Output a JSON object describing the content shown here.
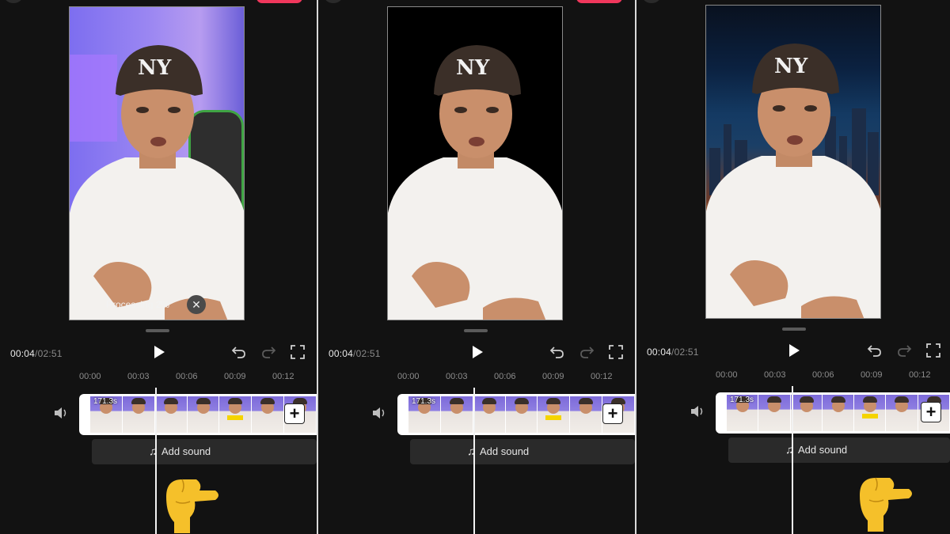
{
  "panels": [
    {
      "processing_label": "Processing 2%",
      "time": {
        "current": "00:04",
        "separator": "/",
        "total": "02:51"
      },
      "ticks": [
        "00:00",
        "00:03",
        "00:06",
        "00:09",
        "00:12"
      ],
      "clip_duration": "171.3s",
      "add_sound_label": "Add sound",
      "background": "purple-room"
    },
    {
      "time": {
        "current": "00:04",
        "separator": "/",
        "total": "02:51"
      },
      "ticks": [
        "00:00",
        "00:03",
        "00:06",
        "00:09",
        "00:12"
      ],
      "clip_duration": "171.3s",
      "add_sound_label": "Add sound",
      "background": "black"
    },
    {
      "time": {
        "current": "00:04",
        "separator": "/",
        "total": "02:51"
      },
      "ticks": [
        "00:00",
        "00:03",
        "00:06",
        "00:09",
        "00:12"
      ],
      "clip_duration": "171.3s",
      "add_sound_label": "Add sound",
      "background": "night-city"
    }
  ],
  "icons": {
    "play": "play-icon",
    "undo": "undo-icon",
    "redo": "redo-icon",
    "fullscreen": "fullscreen-icon",
    "volume": "speaker-icon",
    "add_clip": "plus-icon",
    "music": "music-note-icon",
    "close": "close-icon",
    "pointer": "pointing-hand-icon"
  },
  "glyphs": {
    "plus": "+",
    "note": "♫",
    "close": "✕"
  },
  "colors": {
    "accent": "#f0375c",
    "background": "#121212",
    "timeline_bg": "#2a2a2a"
  }
}
